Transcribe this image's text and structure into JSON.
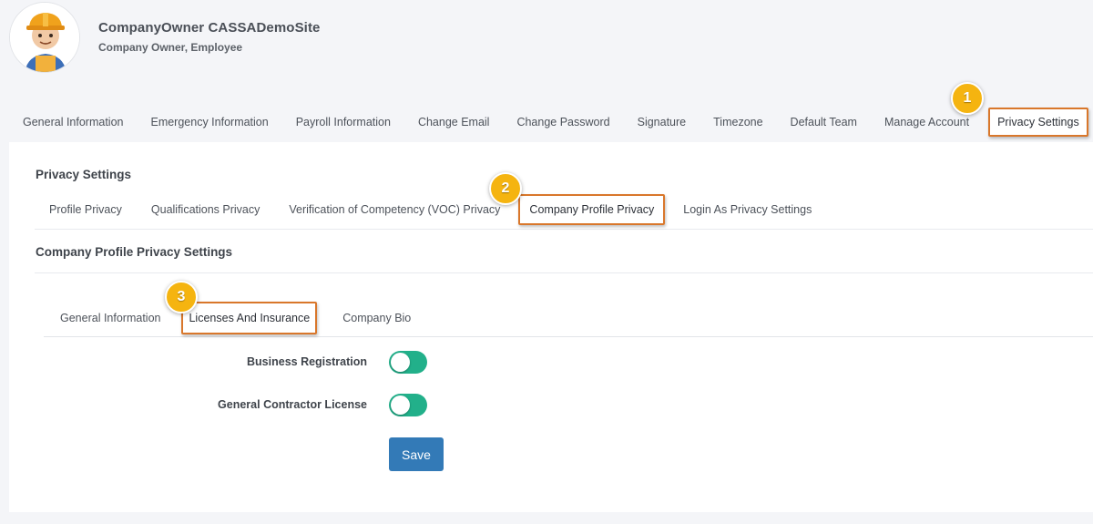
{
  "user": {
    "name": "CompanyOwner CASSADemoSite",
    "roles": "Company Owner, Employee"
  },
  "main_tabs": [
    {
      "label": "General Information"
    },
    {
      "label": "Emergency Information"
    },
    {
      "label": "Payroll Information"
    },
    {
      "label": "Change Email"
    },
    {
      "label": "Change Password"
    },
    {
      "label": "Signature"
    },
    {
      "label": "Timezone"
    },
    {
      "label": "Default Team"
    },
    {
      "label": "Manage Account"
    },
    {
      "label": "Privacy Settings",
      "active": true
    }
  ],
  "privacy": {
    "title": "Privacy Settings",
    "tabs": [
      {
        "label": "Profile Privacy"
      },
      {
        "label": "Qualifications Privacy"
      },
      {
        "label": "Verification of Competency (VOC) Privacy"
      },
      {
        "label": "Company Profile Privacy",
        "active": true
      },
      {
        "label": "Login As Privacy Settings"
      }
    ]
  },
  "company_profile": {
    "title": "Company Profile Privacy Settings",
    "tabs": [
      {
        "label": "General Information"
      },
      {
        "label": "Licenses And Insurance",
        "active": true
      },
      {
        "label": "Company Bio"
      }
    ],
    "fields": [
      {
        "label": "Business Registration",
        "enabled": true
      },
      {
        "label": "General Contractor License",
        "enabled": true
      }
    ],
    "save_label": "Save"
  },
  "markers": [
    "1",
    "2",
    "3"
  ],
  "colors": {
    "highlight_border": "#d9772b",
    "marker": "#f5b410",
    "toggle_on": "#22b08a",
    "save_button": "#337ab7"
  }
}
